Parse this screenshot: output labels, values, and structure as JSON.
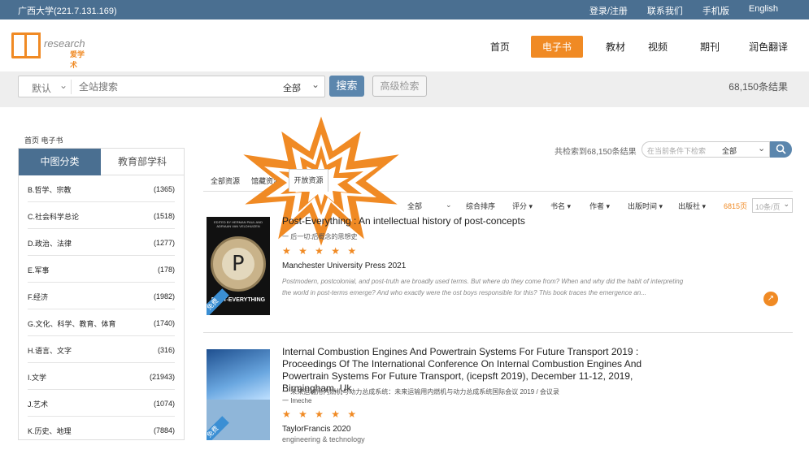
{
  "topbar": {
    "ip": "广西大学(221.7.131.169)",
    "links": [
      "登录/注册",
      "联系我们",
      "手机版",
      "English"
    ]
  },
  "logo": {
    "text": "research",
    "cn": "爱学术"
  },
  "nav": {
    "items": [
      "首页",
      "电子书",
      "教材",
      "视频",
      "期刊",
      "润色翻译"
    ],
    "active": "电子书"
  },
  "search": {
    "scope": "默认",
    "placeholder": "全站搜索",
    "field": "全部",
    "button": "搜索",
    "advanced": "高级检索",
    "result_count": "68,150条结果"
  },
  "breadcrumb": "首页  电子书",
  "sidebar": {
    "tabs": [
      "中图分类",
      "教育部学科"
    ],
    "categories": [
      {
        "name": "B.哲学、宗教",
        "count": "(1365)"
      },
      {
        "name": "C.社会科学总论",
        "count": "(1518)"
      },
      {
        "name": "D.政治、法律",
        "count": "(1277)"
      },
      {
        "name": "E.军事",
        "count": "(178)"
      },
      {
        "name": "F.经济",
        "count": "(1982)"
      },
      {
        "name": "G.文化、科学、教育、体育",
        "count": "(1740)"
      },
      {
        "name": "H.语言、文字",
        "count": "(316)"
      },
      {
        "name": "I.文学",
        "count": "(21943)"
      },
      {
        "name": "J.艺术",
        "count": "(1074)"
      },
      {
        "name": "K.历史、地理",
        "count": "(7884)"
      }
    ]
  },
  "results": {
    "count_text": "共检索到68,150条结果",
    "filter_placeholder": "在当前条件下检索",
    "filter_field": "全部",
    "tabs": [
      "全部资源",
      "馆藏资源",
      "开放资源"
    ],
    "selected_tab": "开放资源",
    "sort": {
      "all": "全部",
      "items": [
        "综合排序",
        "评分 ▾",
        "书名 ▾",
        "作者 ▾",
        "出版时间 ▾",
        "出版社 ▾"
      ],
      "pages": "6815页",
      "per_page": "10条/页"
    },
    "items": [
      {
        "title": "Post-Everything : An intellectual history of post-concepts",
        "subtitle": "一 后一切:后概念的思想史",
        "stars": "★ ★ ★ ★ ★",
        "publisher": "Manchester University Press 2021",
        "abstract": "Postmodern, postcolonial, and post-truth are broadly used terms. But where do they come from? When and why did the habit of interpreting the world in post-terms emerge? And who exactly were the ost boys responsible for this? This book traces the emergence an...",
        "cover_title": "POST-EVERYTHING",
        "cover_authors": "EDITED BY HERMAN PAUL AND ADRIAAN VAN VELDHUIZEN",
        "badge": "免费"
      },
      {
        "title": "Internal Combustion Engines And Powertrain Systems For Future Transport 2019 : Proceedings Of The International Conference On Internal Combustion Engines And Powertrain Systems For Future Transport, (icepsft 2019), December 11-12, 2019, Birmingham, Uk",
        "subtitle": "一 未来运输用内燃机与动力总成系统：未来运输用内燃机与动力总成系统国际会议 2019 / 会议录",
        "author": "一 Imeche",
        "stars": "★ ★ ★ ★ ★",
        "publisher": "TaylorFrancis 2020",
        "tag": "engineering & technology",
        "badge": "免费"
      }
    ]
  },
  "colors": {
    "accent": "#f08a24",
    "primary": "#4a6f91"
  }
}
